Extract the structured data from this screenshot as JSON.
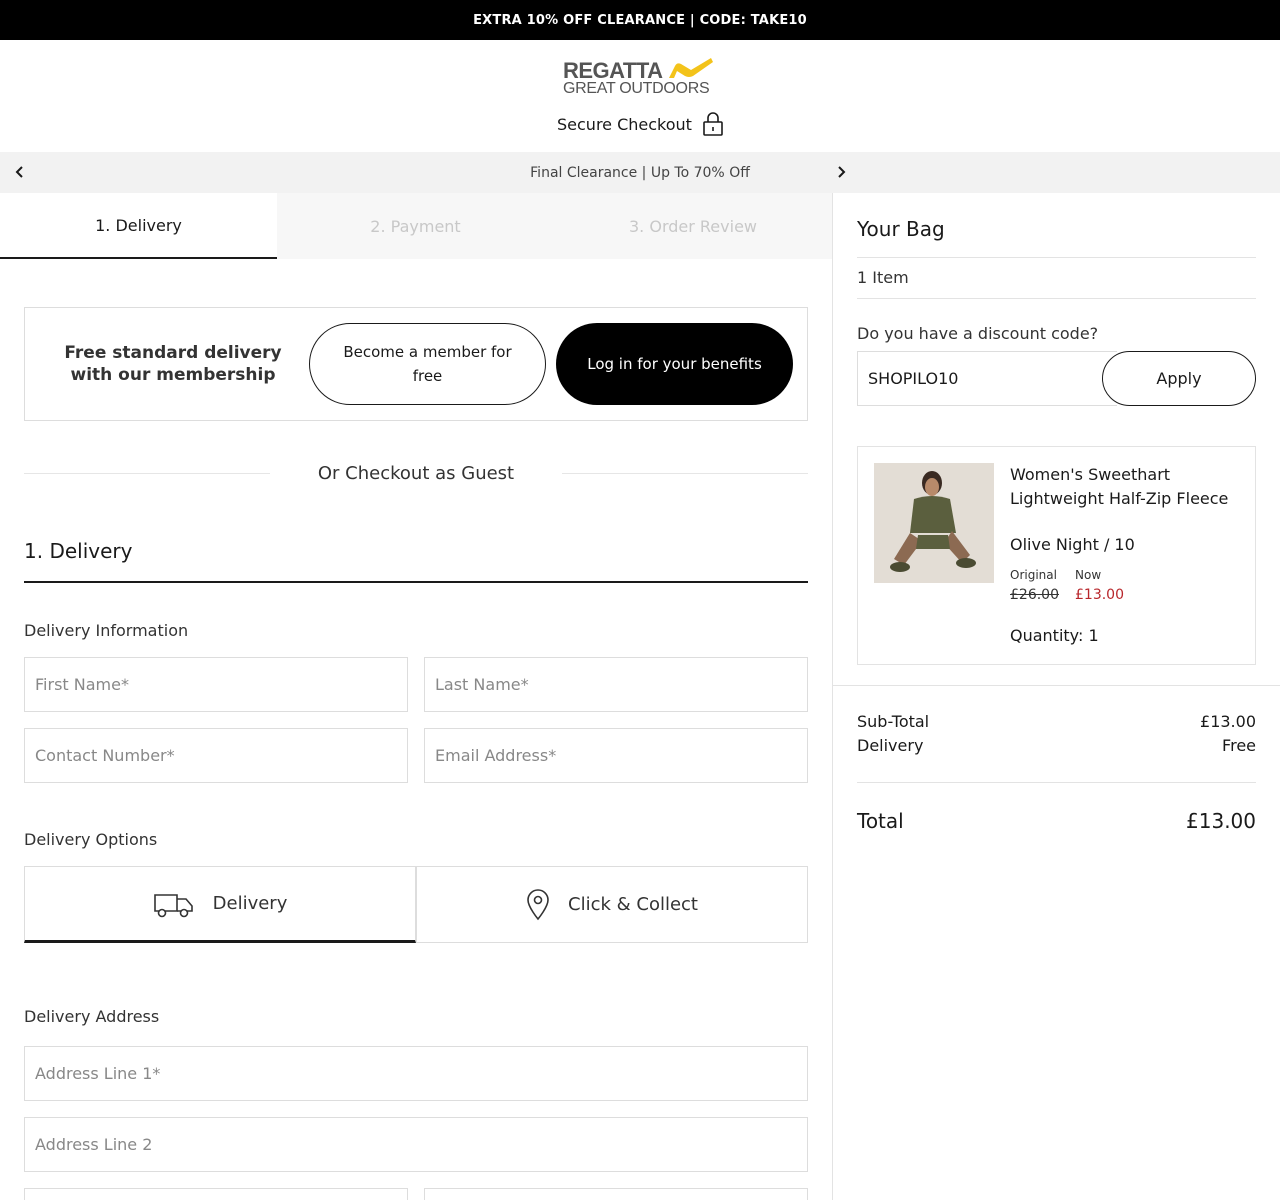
{
  "topbar": {
    "text": "EXTRA 10% OFF CLEARANCE | CODE: TAKE10"
  },
  "header": {
    "logo_line1": "REGATTA",
    "logo_line2": "GREAT OUTDOORS",
    "secure_checkout": "Secure Checkout",
    "brand_color": "#f3c31a"
  },
  "promo": {
    "text": "Final Clearance | Up To 70% Off"
  },
  "steps": [
    {
      "label": "1. Delivery",
      "state": "active"
    },
    {
      "label": "2. Payment",
      "state": "inactive"
    },
    {
      "label": "3. Order Review",
      "state": "inactive"
    }
  ],
  "membership": {
    "text": "Free standard delivery with our membership",
    "become_member": "Become a member for free",
    "login": "Log in for your benefits"
  },
  "guest_divider": "Or Checkout as Guest",
  "delivery_section": {
    "title": "1. Delivery",
    "info_label": "Delivery Information",
    "first_name_placeholder": "First Name*",
    "last_name_placeholder": "Last Name*",
    "contact_placeholder": "Contact Number*",
    "email_placeholder": "Email Address*",
    "options_label": "Delivery Options",
    "option_delivery": "Delivery",
    "option_collect": "Click & Collect",
    "address_label": "Delivery Address",
    "address1_placeholder": "Address Line 1*",
    "address2_placeholder": "Address Line 2"
  },
  "bag": {
    "title": "Your Bag",
    "count": "1 Item",
    "discount_label": "Do you have a discount code?",
    "discount_value": "SHOPILO10",
    "apply": "Apply",
    "item": {
      "name": "Women's Sweethart Lightweight Half-Zip Fleece",
      "variant": "Olive Night / 10",
      "original_label": "Original",
      "now_label": "Now",
      "original_price": "£26.00",
      "now_price": "£13.00",
      "quantity": "Quantity: 1"
    },
    "subtotal_label": "Sub-Total",
    "subtotal_value": "£13.00",
    "delivery_label": "Delivery",
    "delivery_value": "Free",
    "total_label": "Total",
    "total_value": "£13.00",
    "sale_color": "#b8262b"
  }
}
